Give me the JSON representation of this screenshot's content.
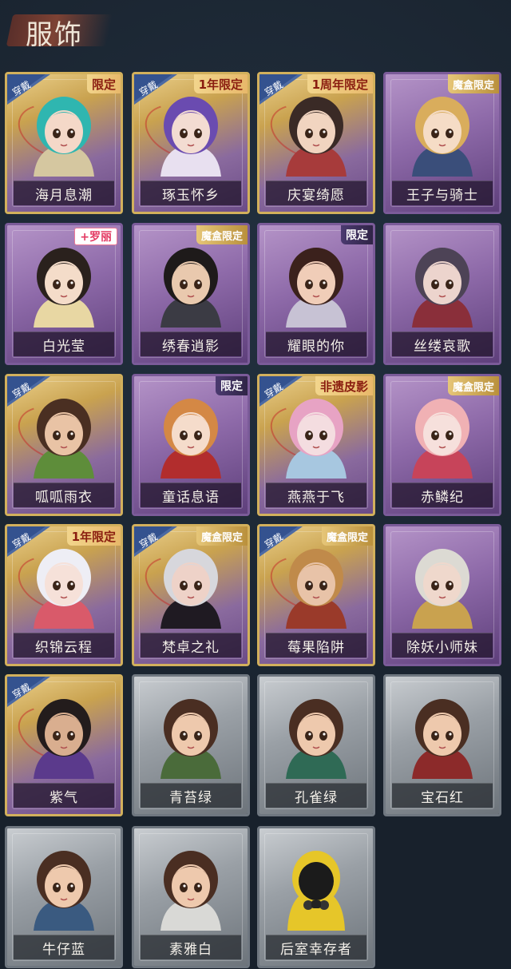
{
  "header": {
    "title": "服饰"
  },
  "wear_label": "穿戴",
  "cards": [
    {
      "name": "海月息潮",
      "frame": "gold",
      "tag": "限定",
      "tag_style": "red",
      "worn": true,
      "palette": {
        "hair": "#2fb6b0",
        "skin": "#f4d8c8",
        "cloth": "#d5c7a0"
      }
    },
    {
      "name": "琢玉怀乡",
      "frame": "gold",
      "tag": "1年限定",
      "tag_style": "red",
      "worn": true,
      "palette": {
        "hair": "#6a4bb0",
        "skin": "#f3dcd2",
        "cloth": "#e8e0f0"
      }
    },
    {
      "name": "庆宴绮愿",
      "frame": "gold",
      "tag": "1周年限定",
      "tag_style": "red",
      "worn": true,
      "palette": {
        "hair": "#3a2a26",
        "skin": "#f1d4c0",
        "cloth": "#a73b3b"
      }
    },
    {
      "name": "王子与骑士",
      "frame": "purple",
      "tag": "魔盒限定",
      "tag_style": "gold",
      "worn": false,
      "palette": {
        "hair": "#d9ad5c",
        "skin": "#f5dcc6",
        "cloth": "#3a4e7a"
      }
    },
    {
      "name": "白光莹",
      "frame": "purple",
      "tag": "+罗丽",
      "tag_style": "pinkbox",
      "worn": false,
      "palette": {
        "hair": "#2a211d",
        "skin": "#f4dcc9",
        "cloth": "#e8d7a3"
      }
    },
    {
      "name": "绣春逍影",
      "frame": "purple",
      "tag": "魔盒限定",
      "tag_style": "gold",
      "worn": false,
      "palette": {
        "hair": "#1e1a1a",
        "skin": "#e9c9ae",
        "cloth": "#3b3b44"
      }
    },
    {
      "name": "耀眼的你",
      "frame": "purple",
      "tag": "限定",
      "tag_style": "deep",
      "worn": false,
      "palette": {
        "hair": "#3b211c",
        "skin": "#f0cdb8",
        "cloth": "#c7c2d4"
      }
    },
    {
      "name": "丝缕哀歌",
      "frame": "purple",
      "tag": "",
      "tag_style": "",
      "worn": false,
      "palette": {
        "hair": "#4d4356",
        "skin": "#ecd4cd",
        "cloth": "#8a2f3a"
      }
    },
    {
      "name": "呱呱雨衣",
      "frame": "gold",
      "tag": "",
      "tag_style": "",
      "worn": true,
      "palette": {
        "hair": "#4a2f22",
        "skin": "#e9c3a5",
        "cloth": "#5e8d3a"
      }
    },
    {
      "name": "童话息语",
      "frame": "purple",
      "tag": "限定",
      "tag_style": "deep",
      "worn": false,
      "palette": {
        "hair": "#d48845",
        "skin": "#f5dccb",
        "cloth": "#b22d2d"
      }
    },
    {
      "name": "燕燕于飞",
      "frame": "gold",
      "tag": "非遗皮影",
      "tag_style": "red",
      "worn": true,
      "palette": {
        "hair": "#e7a3c4",
        "skin": "#f4dde0",
        "cloth": "#a7c7e0"
      }
    },
    {
      "name": "赤鳞纪",
      "frame": "purple",
      "tag": "魔盒限定",
      "tag_style": "gold",
      "worn": false,
      "palette": {
        "hair": "#f0b1b4",
        "skin": "#f6e0dc",
        "cloth": "#c7445a"
      }
    },
    {
      "name": "织锦云程",
      "frame": "gold",
      "tag": "1年限定",
      "tag_style": "red",
      "worn": true,
      "palette": {
        "hair": "#eeeef5",
        "skin": "#f6e1d9",
        "cloth": "#d95a6a"
      }
    },
    {
      "name": "梵卓之礼",
      "frame": "gold",
      "tag": "魔盒限定",
      "tag_style": "gold",
      "worn": true,
      "palette": {
        "hair": "#d7d7dc",
        "skin": "#eed2c8",
        "cloth": "#1f1a22"
      }
    },
    {
      "name": "莓果陷阱",
      "frame": "gold",
      "tag": "魔盒限定",
      "tag_style": "gold",
      "worn": true,
      "palette": {
        "hair": "#c08a4a",
        "skin": "#e8c3a8",
        "cloth": "#9a3a2a"
      }
    },
    {
      "name": "除妖小师妹",
      "frame": "purple",
      "tag": "",
      "tag_style": "",
      "worn": false,
      "palette": {
        "hair": "#dcdad3",
        "skin": "#efd8cc",
        "cloth": "#c9a24f"
      }
    },
    {
      "name": "紫气",
      "frame": "gold",
      "tag": "",
      "tag_style": "",
      "worn": true,
      "palette": {
        "hair": "#231c1c",
        "skin": "#d9ae8f",
        "cloth": "#5b3a8c"
      }
    },
    {
      "name": "青苔绿",
      "frame": "gray",
      "tag": "",
      "tag_style": "",
      "worn": false,
      "palette": {
        "hair": "#4a2e22",
        "skin": "#eec9ad",
        "cloth": "#4a6b3a"
      }
    },
    {
      "name": "孔雀绿",
      "frame": "gray",
      "tag": "",
      "tag_style": "",
      "worn": false,
      "palette": {
        "hair": "#4a2e22",
        "skin": "#eec9ad",
        "cloth": "#2f6a55"
      }
    },
    {
      "name": "宝石红",
      "frame": "gray",
      "tag": "",
      "tag_style": "",
      "worn": false,
      "palette": {
        "hair": "#4a2e22",
        "skin": "#eec9ad",
        "cloth": "#8c2a2a"
      }
    },
    {
      "name": "牛仔蓝",
      "frame": "gray",
      "tag": "",
      "tag_style": "",
      "worn": false,
      "palette": {
        "hair": "#4a2e22",
        "skin": "#eec9ad",
        "cloth": "#3a5a80"
      }
    },
    {
      "name": "素雅白",
      "frame": "gray",
      "tag": "",
      "tag_style": "",
      "worn": false,
      "palette": {
        "hair": "#4a2e22",
        "skin": "#eec9ad",
        "cloth": "#d9d9d6"
      }
    },
    {
      "name": "后室幸存者",
      "frame": "gray",
      "tag": "",
      "tag_style": "",
      "worn": false,
      "palette": {
        "hair": "#e6c629",
        "skin": "#1b1b1b",
        "cloth": "#e6c629"
      }
    }
  ]
}
